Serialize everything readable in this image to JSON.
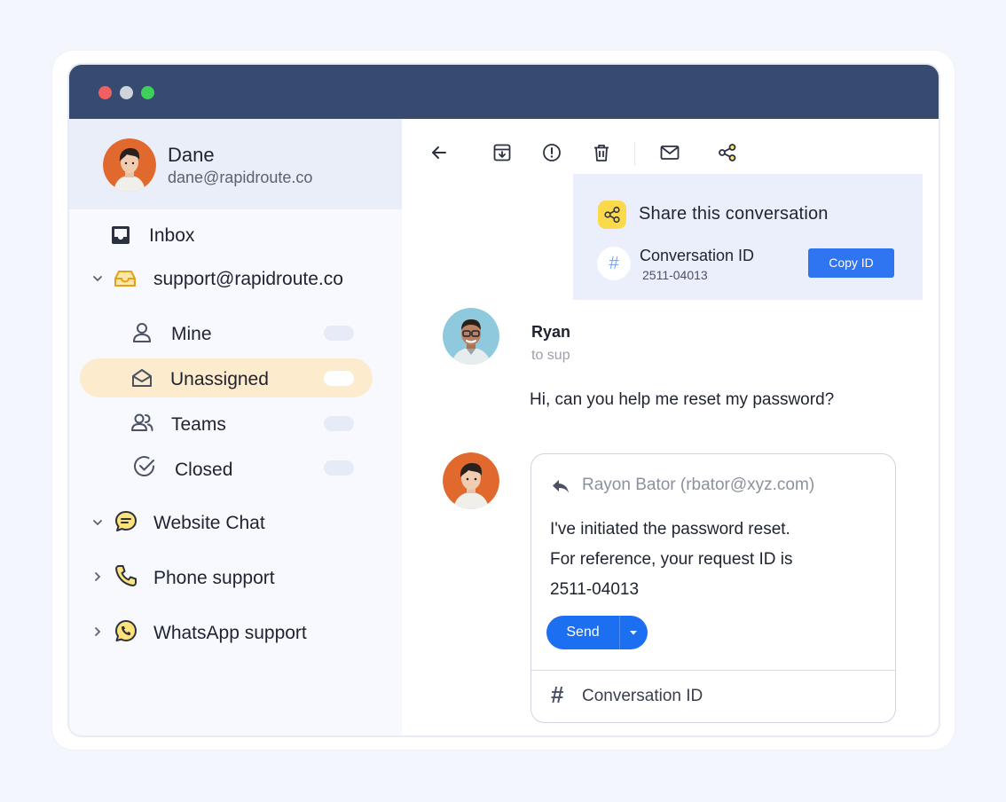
{
  "profile": {
    "name": "Dane",
    "email": "dane@rapidroute.co"
  },
  "sidebar": {
    "inbox": "Inbox",
    "mailbox": "support@rapidroute.co",
    "items": [
      {
        "label": "Mine"
      },
      {
        "label": "Unassigned"
      },
      {
        "label": "Teams"
      },
      {
        "label": "Closed"
      }
    ],
    "channels": [
      {
        "label": "Website Chat"
      },
      {
        "label": "Phone support"
      },
      {
        "label": "WhatsApp support"
      }
    ]
  },
  "share": {
    "title": "Share this conversation",
    "conv_label": "Conversation ID",
    "conv_id": "2511-04013",
    "copy_label": "Copy ID"
  },
  "message": {
    "sender": "Ryan",
    "to": "to sup",
    "text": "Hi, can you help me reset my password?"
  },
  "reply": {
    "to": "Rayon Bator (rbator@xyz.com)",
    "lines": [
      "I've initiated the password reset.",
      "For reference, your request ID is",
      "2511-04013"
    ],
    "send_label": "Send",
    "hash": "#",
    "conv_label": "Conversation ID"
  },
  "colors": {
    "titlebar": "#374a6f",
    "accent": "#2f74f1",
    "active": "#fdebcd",
    "badge": "#fcd94b"
  }
}
